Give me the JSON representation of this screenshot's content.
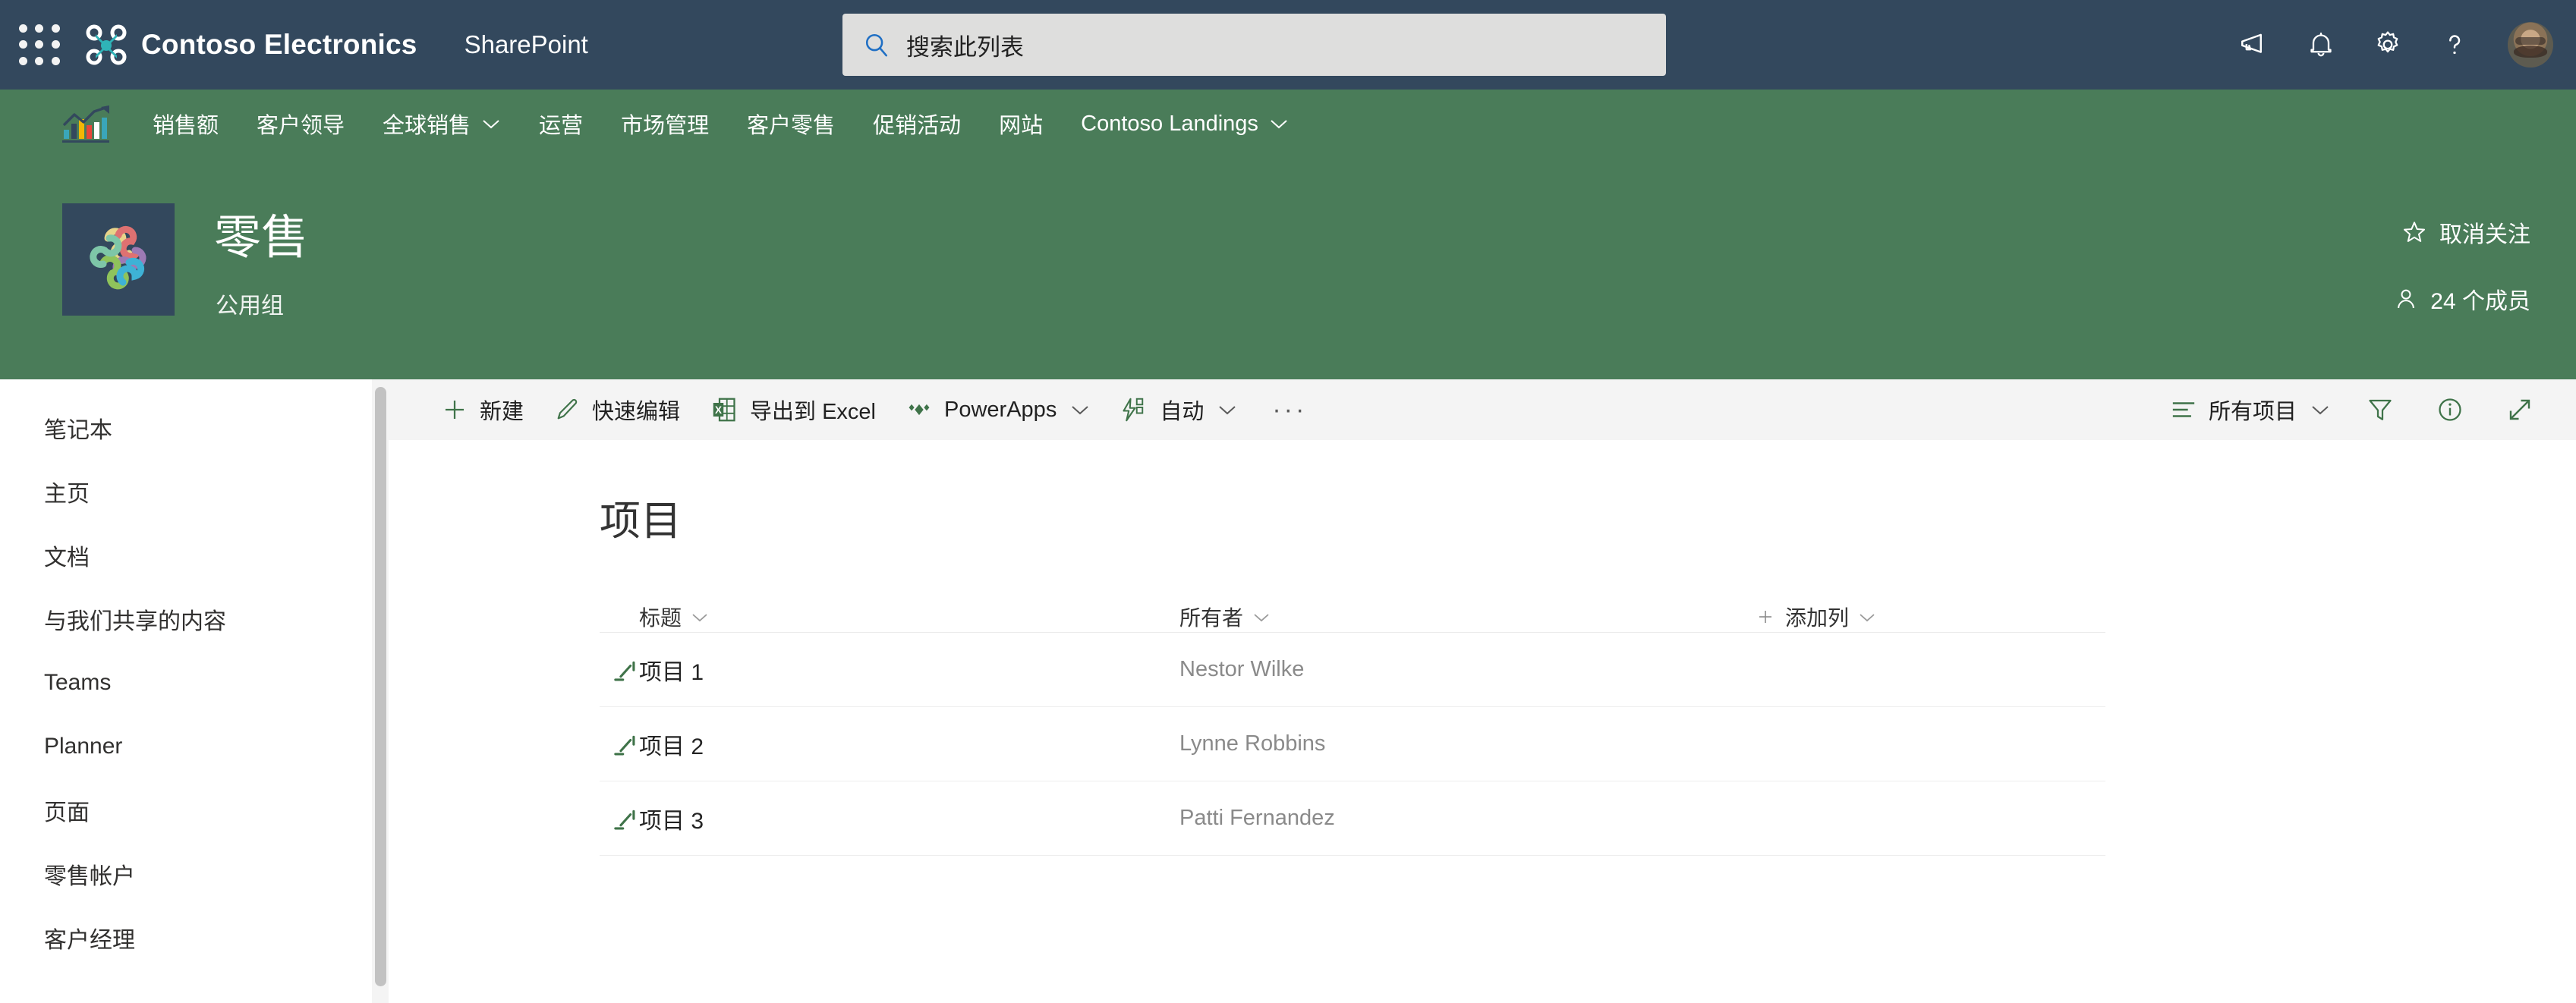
{
  "suite": {
    "waffle_label": "应用启动器",
    "brand": "Contoso Electronics",
    "app": "SharePoint",
    "search": {
      "placeholder": "搜索此列表",
      "value": ""
    },
    "icons": [
      {
        "name": "megaphone-icon",
        "label": "通知中心"
      },
      {
        "name": "bell-icon",
        "label": "通知"
      },
      {
        "name": "gear-icon",
        "label": "设置"
      },
      {
        "name": "help-icon",
        "label": "帮助"
      }
    ],
    "avatar_label": "用户头像"
  },
  "topnav": {
    "logo_label": "Contoso 销售标志",
    "items": [
      {
        "label": "销售额",
        "has_chevron": false
      },
      {
        "label": "客户领导",
        "has_chevron": false
      },
      {
        "label": "全球销售",
        "has_chevron": true
      },
      {
        "label": "运营",
        "has_chevron": false
      },
      {
        "label": "市场管理",
        "has_chevron": false
      },
      {
        "label": "客户零售",
        "has_chevron": false
      },
      {
        "label": "促销活动",
        "has_chevron": false
      },
      {
        "label": "网站",
        "has_chevron": false
      },
      {
        "label": "Contoso Landings",
        "has_chevron": true
      }
    ]
  },
  "site": {
    "title": "零售",
    "subtitle": "公用组",
    "follow_label": "取消关注",
    "members_label": "24 个成员",
    "member_count": "24"
  },
  "sidebar": {
    "items": [
      {
        "label": "笔记本"
      },
      {
        "label": "主页"
      },
      {
        "label": "文档"
      },
      {
        "label": "与我们共享的内容"
      },
      {
        "label": "Teams"
      },
      {
        "label": "Planner"
      },
      {
        "label": "页面"
      },
      {
        "label": "零售帐户"
      },
      {
        "label": "客户经理"
      }
    ]
  },
  "commandbar": {
    "new_label": "新建",
    "quick_edit_label": "快速编辑",
    "export_excel_label": "导出到 Excel",
    "powerapps_label": "PowerApps",
    "automate_label": "自动",
    "more_label": "···",
    "view_label": "所有项目",
    "filter_label": "筛选器",
    "info_label": "信息",
    "expand_label": "全屏"
  },
  "list": {
    "title": "项目",
    "columns": [
      {
        "label": "标题",
        "has_chevron": true
      },
      {
        "label": "所有者",
        "has_chevron": true
      },
      {
        "label": "添加列",
        "has_chevron": true,
        "has_plus": true
      }
    ],
    "rows": [
      {
        "title": "项目 1",
        "owner": "Nestor Wilke",
        "is_new": true
      },
      {
        "title": "项目 2",
        "owner": "Lynne Robbins",
        "is_new": true
      },
      {
        "title": "项目 3",
        "owner": "Patti Fernandez",
        "is_new": true
      }
    ]
  },
  "colors": {
    "suite_bar": "#33485d",
    "site_theme_green": "#4a7c59",
    "accent_green": "#3f7349",
    "command_bar_bg": "#f4f4f4",
    "search_bg": "#dededd",
    "brand_teal": "#2fb3b8"
  }
}
